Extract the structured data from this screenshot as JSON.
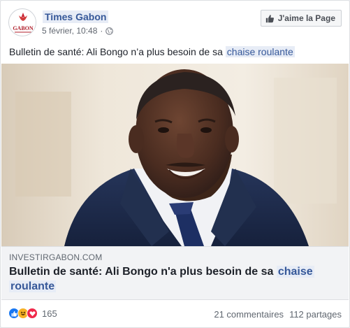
{
  "post": {
    "page_name": "Times Gabon",
    "timestamp": "5 février, 10:48",
    "like_page_label": "J'aime la Page",
    "text_prefix": "Bulletin de santé: Ali Bongo n’a plus besoin de sa ",
    "text_highlight": "chaise roulante",
    "avatar_logo_text": "GABON"
  },
  "link_preview": {
    "domain": "INVESTIRGABON.COM",
    "title_prefix": "Bulletin de santé: Ali Bongo n'a plus besoin de sa ",
    "title_highlight": "chaise",
    "title_line2": "roulante"
  },
  "footer": {
    "reaction_count": "165",
    "comments": "21 commentaires",
    "shares": "112 partages"
  },
  "colors": {
    "link_blue": "#365899",
    "highlight_bg": "#e7ecf6",
    "like_reaction": "#1877f2",
    "haha_reaction": "#f7b125",
    "love_reaction": "#f0284a",
    "suit_navy": "#1f2d4f"
  }
}
